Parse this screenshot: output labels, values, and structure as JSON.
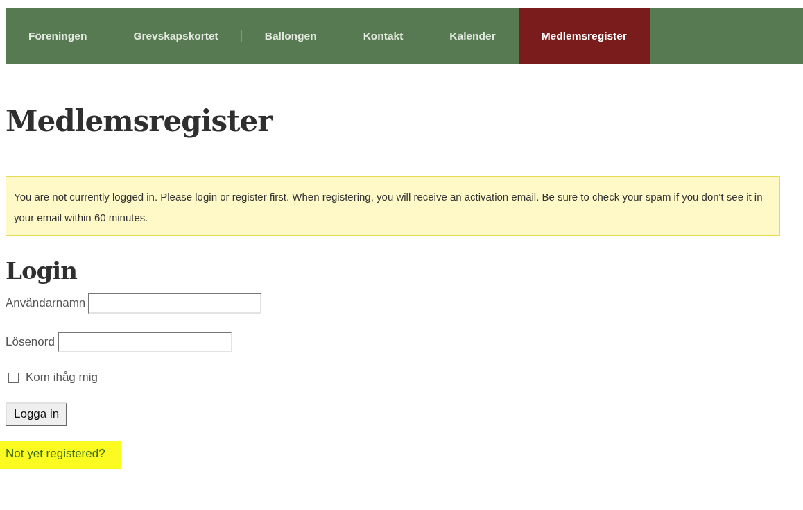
{
  "nav": {
    "items": [
      {
        "label": "Föreningen",
        "selected": false
      },
      {
        "label": "Grevskapskortet",
        "selected": false
      },
      {
        "label": "Ballongen",
        "selected": false
      },
      {
        "label": "Kontakt",
        "selected": false
      },
      {
        "label": "Kalender",
        "selected": false
      },
      {
        "label": "Medlemsregister",
        "selected": true
      }
    ]
  },
  "page_title": "Medlemsregister",
  "notice": "You are not currently logged in. Please login or register first. When registering, you will receive an activation email. Be sure to check your spam if you don't see it in your email within 60 minutes.",
  "login": {
    "title": "Login",
    "fields": [
      {
        "label": "Användarnamn",
        "kind": "text"
      },
      {
        "label": "Lösenord",
        "kind": "password"
      }
    ],
    "remember": {
      "label": "Kom ihåg mig",
      "checked": false
    },
    "button": "Logga in",
    "register_link": "Not yet registered?"
  }
}
